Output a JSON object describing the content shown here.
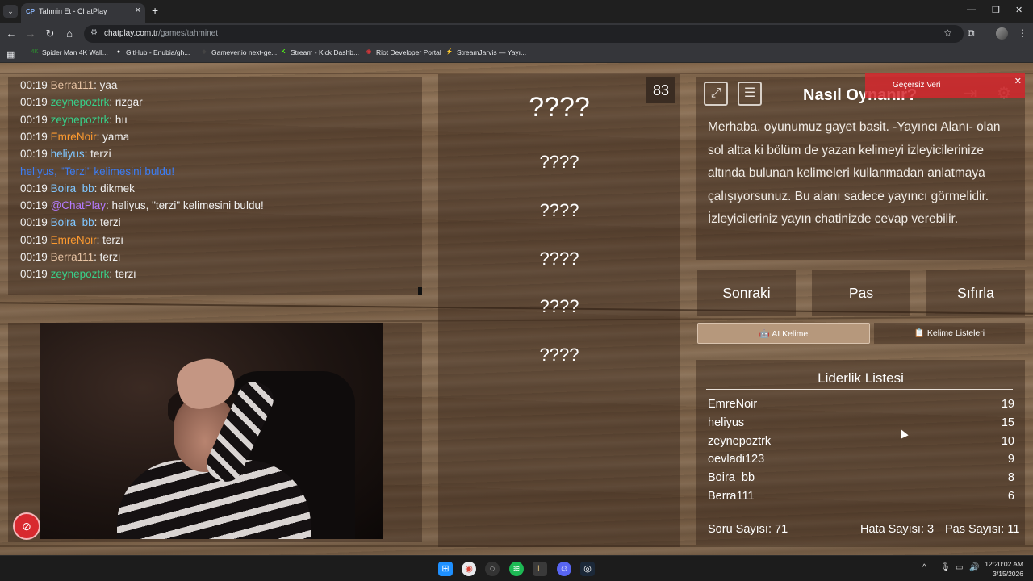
{
  "browser": {
    "tab_favicon": "CP",
    "tab_title": "Tahmin Et - ChatPlay",
    "url_host": "chatplay.com.tr",
    "url_path": "/games/tahminet",
    "bookmarks": [
      {
        "icon": "4K",
        "label": "Spider Man 4K Wall...",
        "color": "#2e7d32"
      },
      {
        "icon": "●",
        "label": "GitHub - Enubia/gh...",
        "color": "#ffffff"
      },
      {
        "icon": "◆",
        "label": "Gamever.io next-ge...",
        "color": "#444444"
      },
      {
        "icon": "K",
        "label": "Stream - Kick Dashb...",
        "color": "#53fc18"
      },
      {
        "icon": "◉",
        "label": "Riot Developer Portal",
        "color": "#d13639"
      },
      {
        "icon": "⚡",
        "label": "StreamJarvis — Yayı...",
        "color": "#ff9800"
      }
    ]
  },
  "chat": {
    "lines": [
      {
        "time": "00:19",
        "user": "Berra111",
        "color": "#e8c4a4",
        "text": ": yaa"
      },
      {
        "time": "00:19",
        "user": "zeynepoztrk",
        "color": "#38d08a",
        "text": ": rizgar"
      },
      {
        "time": "00:19",
        "user": "zeynepoztrk",
        "color": "#38d08a",
        "text": ": hıı"
      },
      {
        "time": "00:19",
        "user": "EmreNoir",
        "color": "#ff9b2f",
        "text": ": yama"
      },
      {
        "time": "00:19",
        "user": "heliyus",
        "color": "#7fc6ff",
        "text": ": terzi"
      },
      {
        "time": "",
        "user": "heliyus, \"Terzi\" kelimesini buldu!",
        "color": "#3d7df2",
        "text": ""
      },
      {
        "time": "00:19",
        "user": "Boira_bb",
        "color": "#7fc6ff",
        "text": ": dikmek"
      },
      {
        "time": "00:19",
        "user": "@ChatPlay",
        "color": "#b57bff",
        "text": ": heliyus, \"terzi\" kelimesini buldu!"
      },
      {
        "time": "00:19",
        "user": "Boira_bb",
        "color": "#7fc6ff",
        "text": ": terzi"
      },
      {
        "time": "00:19",
        "user": "EmreNoir",
        "color": "#ff9b2f",
        "text": ": terzi"
      },
      {
        "time": "00:19",
        "user": "Berra111",
        "color": "#e8c4a4",
        "text": ": terzi"
      },
      {
        "time": "00:19",
        "user": "zeynepoztrk",
        "color": "#38d08a",
        "text": ": terzi"
      }
    ]
  },
  "game": {
    "counter": "83",
    "main_word": "????",
    "words": [
      "????",
      "????",
      "????",
      "????",
      "????"
    ]
  },
  "howto": {
    "title": "Nasıl Oynanır?",
    "text": "Merhaba, oyunumuz gayet basit. -Yayıncı Alanı- olan sol altta ki bölüm de yazan kelimeyi izleyicilerinize altında bulunan kelimeleri kullanmadan anlatmaya çalışıyorsunuz. Bu alanı sadece yayıncı görmelidir. İzleyicileriniz yayın chatinizde cevap verebilir."
  },
  "toast": {
    "text": "Geçersiz Veri"
  },
  "controls": {
    "next": "Sonraki",
    "pass": "Pas",
    "reset": "Sıfırla",
    "ai_word": "AI Kelime",
    "word_lists": "Kelime Listeleri"
  },
  "leaderboard": {
    "title": "Liderlik Listesi",
    "rows": [
      {
        "name": "EmreNoir",
        "score": "19"
      },
      {
        "name": "heliyus",
        "score": "15"
      },
      {
        "name": "zeynepoztrk",
        "score": "10"
      },
      {
        "name": "oevladi123",
        "score": "9"
      },
      {
        "name": "Boira_bb",
        "score": "8"
      },
      {
        "name": "Berra111",
        "score": "6"
      }
    ],
    "questions": "Soru Sayısı: 71",
    "errors": "Hata Sayısı: 3",
    "passes": "Pas Sayısı: 11"
  },
  "taskbar": {
    "time": "12:20:02 AM",
    "date": "3/15/2026"
  }
}
